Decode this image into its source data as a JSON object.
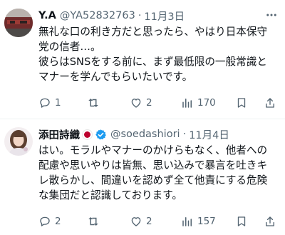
{
  "tweets": [
    {
      "name": "Y.A",
      "handle": "@YA52832763",
      "separator": "·",
      "date": "11月3日",
      "lines": [
        "無礼な口の利き方だと思ったら、やはり日本保守",
        "党の信者…。",
        "彼らはSNSをする前に、まず最低限の一般常識と",
        "マナーを学んでもらいたいです。"
      ],
      "counts": {
        "reply": "1",
        "retweet": "",
        "like": "2",
        "views": "170"
      }
    },
    {
      "name": "添田詩織",
      "handle": "@soedashiori",
      "separator": "·",
      "date": "11月4日",
      "lines": [
        "はい。モラルやマナーのかけらもなく、他者への",
        "配慮や思いやりは皆無、思い込みで暴言を吐きキ",
        "レ散らかし、間違いを認めず全て他責にする危険",
        "な集団だと認識しております。"
      ],
      "counts": {
        "reply": "2",
        "retweet": "",
        "like": "2",
        "views": "157"
      }
    }
  ],
  "colors": {
    "text": "#0f1419",
    "muted": "#536471",
    "verified": "#1d9bf0",
    "flag_red": "#bc002d",
    "divider": "#eff3f4"
  },
  "icons": [
    "reply-icon",
    "retweet-icon",
    "like-icon",
    "views-icon",
    "bookmark-icon",
    "share-icon",
    "more-icon",
    "verified-badge-icon",
    "japan-flag-icon"
  ]
}
